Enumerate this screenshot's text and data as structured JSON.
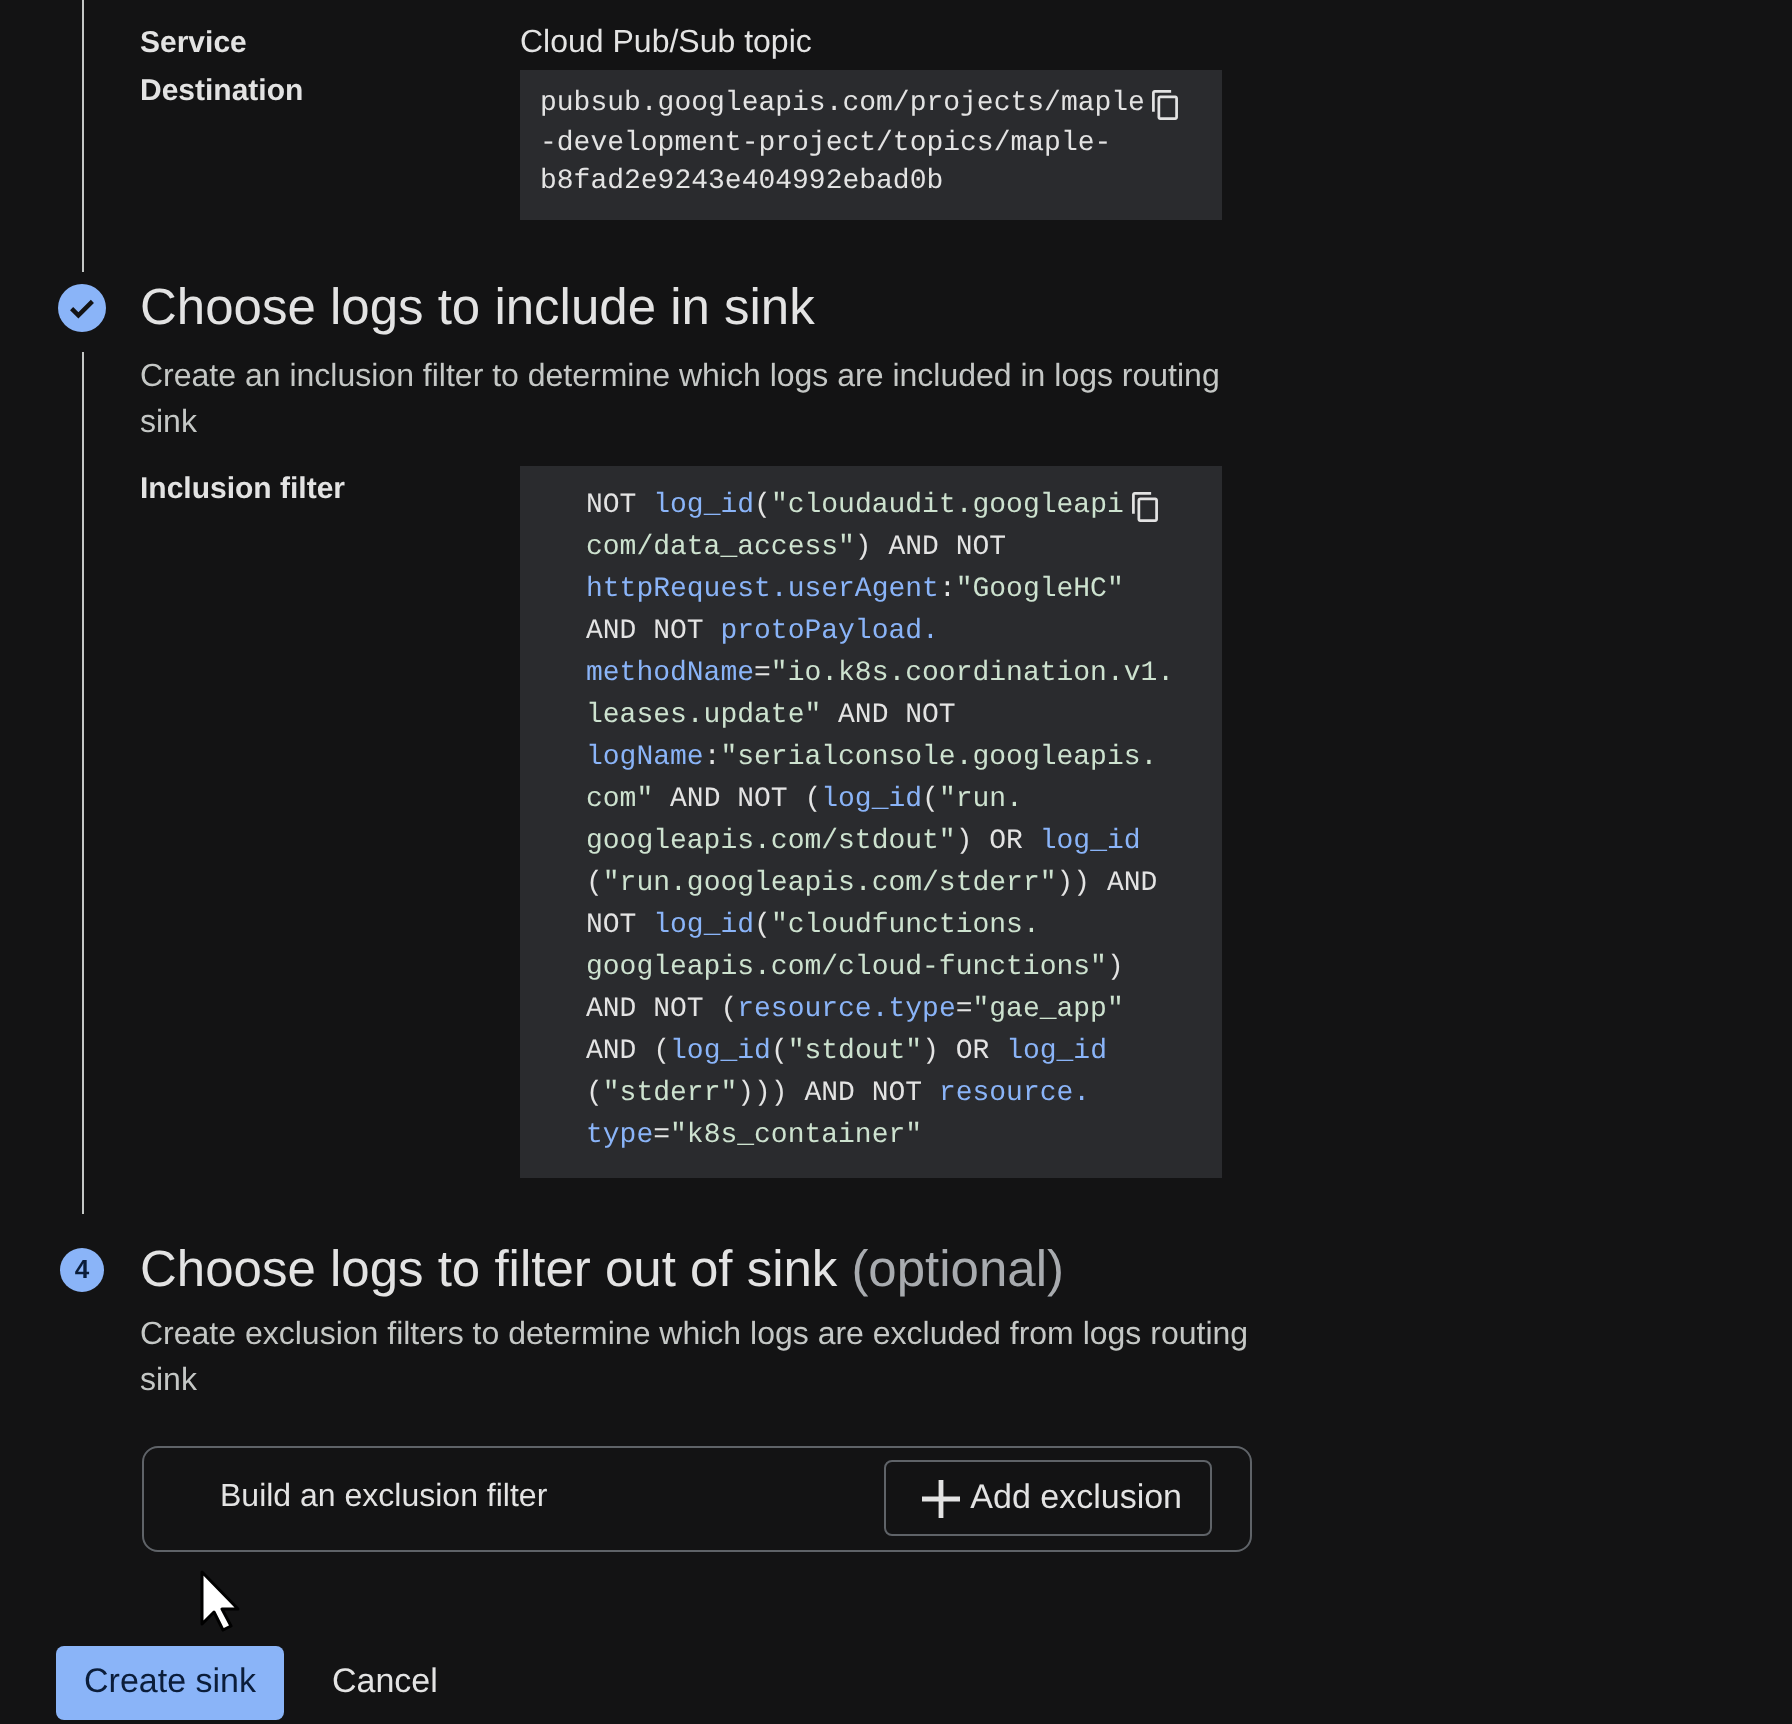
{
  "destination": {
    "label": "Service Destination",
    "type_label": "Cloud Pub/Sub topic",
    "lines": [
      "pubsub.googleapis.com/projects/maple",
      "-development-project/topics/maple-",
      "b8fad2e9243e404992ebad0b"
    ]
  },
  "steps": [
    {
      "completed": true,
      "title": "Choose logs to include in sink",
      "description": "Create an inclusion filter to determine which logs are included in logs routing sink",
      "filter": {
        "label": "Inclusion filter",
        "lines": [
          [
            {
              "kind": "plain",
              "text": "NOT "
            },
            {
              "kind": "field",
              "text": "log_id"
            },
            {
              "kind": "plain",
              "text": "("
            },
            {
              "kind": "string",
              "text": "\"cloudaudit.googleapi"
            }
          ],
          [
            {
              "kind": "string",
              "text": "com/data_access\""
            },
            {
              "kind": "plain",
              "text": ") AND NOT"
            }
          ],
          [
            {
              "kind": "field",
              "text": "httpRequest.userAgent"
            },
            {
              "kind": "plain",
              "text": ":"
            },
            {
              "kind": "string",
              "text": "\"GoogleHC\""
            }
          ],
          [
            {
              "kind": "plain",
              "text": "AND NOT "
            },
            {
              "kind": "field",
              "text": "protoPayload."
            }
          ],
          [
            {
              "kind": "field",
              "text": "methodName"
            },
            {
              "kind": "plain",
              "text": "="
            },
            {
              "kind": "string",
              "text": "\"io.k8s.coordination.v1."
            }
          ],
          [
            {
              "kind": "string",
              "text": "leases.update\""
            },
            {
              "kind": "plain",
              "text": " AND NOT"
            }
          ],
          [
            {
              "kind": "field",
              "text": "logName"
            },
            {
              "kind": "plain",
              "text": ":"
            },
            {
              "kind": "string",
              "text": "\"serialconsole.googleapis."
            }
          ],
          [
            {
              "kind": "string",
              "text": "com\""
            },
            {
              "kind": "plain",
              "text": " AND NOT ("
            },
            {
              "kind": "field",
              "text": "log_id"
            },
            {
              "kind": "plain",
              "text": "("
            },
            {
              "kind": "string",
              "text": "\"run."
            }
          ],
          [
            {
              "kind": "string",
              "text": "googleapis.com/stdout\""
            },
            {
              "kind": "plain",
              "text": ") OR "
            },
            {
              "kind": "field",
              "text": "log_id"
            }
          ],
          [
            {
              "kind": "plain",
              "text": "("
            },
            {
              "kind": "string",
              "text": "\"run.googleapis.com/stderr\""
            },
            {
              "kind": "plain",
              "text": ")) AND"
            }
          ],
          [
            {
              "kind": "plain",
              "text": "NOT "
            },
            {
              "kind": "field",
              "text": "log_id"
            },
            {
              "kind": "plain",
              "text": "("
            },
            {
              "kind": "string",
              "text": "\"cloudfunctions."
            }
          ],
          [
            {
              "kind": "string",
              "text": "googleapis.com/cloud-functions\""
            },
            {
              "kind": "plain",
              "text": ")"
            }
          ],
          [
            {
              "kind": "plain",
              "text": "AND NOT ("
            },
            {
              "kind": "field",
              "text": "resource.type"
            },
            {
              "kind": "plain",
              "text": "="
            },
            {
              "kind": "string",
              "text": "\"gae_app\""
            }
          ],
          [
            {
              "kind": "plain",
              "text": "AND ("
            },
            {
              "kind": "field",
              "text": "log_id"
            },
            {
              "kind": "plain",
              "text": "("
            },
            {
              "kind": "string",
              "text": "\"stdout\""
            },
            {
              "kind": "plain",
              "text": ") OR "
            },
            {
              "kind": "field",
              "text": "log_id"
            }
          ],
          [
            {
              "kind": "plain",
              "text": "("
            },
            {
              "kind": "string",
              "text": "\"stderr\""
            },
            {
              "kind": "plain",
              "text": "))) AND NOT "
            },
            {
              "kind": "field",
              "text": "resource."
            }
          ],
          [
            {
              "kind": "field",
              "text": "type"
            },
            {
              "kind": "plain",
              "text": "="
            },
            {
              "kind": "string",
              "text": "\"k8s_container\""
            }
          ]
        ]
      }
    },
    {
      "completed": false,
      "number": "4",
      "title": "Choose logs to filter out of sink",
      "title_suffix": "(optional)",
      "description": "Create exclusion filters to determine which logs are excluded from logs routing sink",
      "exclusion": {
        "prompt": "Build an exclusion filter",
        "button": "Add exclusion"
      }
    }
  ],
  "actions": [
    {
      "label": "Create sink",
      "kind": "primary"
    },
    {
      "label": "Cancel",
      "kind": "text"
    }
  ]
}
